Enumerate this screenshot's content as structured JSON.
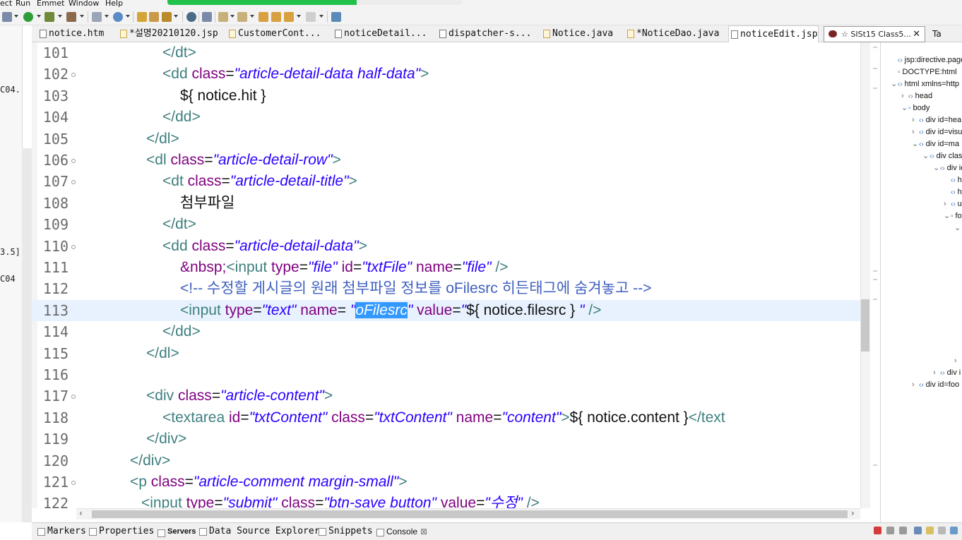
{
  "menu": [
    "ect",
    "Run",
    "Emmet",
    "Window",
    "Help"
  ],
  "progress": 0.64,
  "left_fragments": [
    "C04.",
    "3.5]",
    "C04"
  ],
  "tabs": [
    {
      "label": "notice.htm",
      "kind": "file"
    },
    {
      "label": "*설명20210120.jsp",
      "kind": "java"
    },
    {
      "label": "CustomerCont...",
      "kind": "java"
    },
    {
      "label": "noticeDetail...",
      "kind": "file"
    },
    {
      "label": "dispatcher-s...",
      "kind": "file"
    },
    {
      "label": "Notice.java",
      "kind": "java"
    },
    {
      "label": "*NoticeDao.java",
      "kind": "java"
    },
    {
      "label": "noticeEdit.jsp",
      "kind": "file",
      "active": true
    }
  ],
  "tab_overflow": {
    "label": "☆ SISt15 Class5...",
    "close": "✕"
  },
  "outline_tab": "Ta",
  "code_lines": [
    {
      "n": "101",
      "fold": false,
      "html": "<span class=\"tag\">&lt;/dt&gt;</span>",
      "indent": 230
    },
    {
      "n": "102",
      "fold": true,
      "html": "<span class=\"tag\">&lt;dd </span><span class=\"attr\">class</span><span class=\"txt\">=</span><span class=\"val\">\"article-detail-data half-data\"</span><span class=\"tag\">&gt;</span>",
      "indent": 230
    },
    {
      "n": "103",
      "fold": false,
      "html": "<span class=\"txt\">${ notice.hit }</span>",
      "indent": 255
    },
    {
      "n": "104",
      "fold": false,
      "html": "<span class=\"tag\">&lt;/dd&gt;</span>",
      "indent": 230
    },
    {
      "n": "105",
      "fold": false,
      "html": "<span class=\"tag\">&lt;/dl&gt;</span>",
      "indent": 207
    },
    {
      "n": "106",
      "fold": true,
      "html": "<span class=\"tag\">&lt;dl </span><span class=\"attr\">class</span><span class=\"txt\">=</span><span class=\"val\">\"article-detail-row\"</span><span class=\"tag\">&gt;</span>",
      "indent": 207
    },
    {
      "n": "107",
      "fold": true,
      "html": "<span class=\"tag\">&lt;dt </span><span class=\"attr\">class</span><span class=\"txt\">=</span><span class=\"val\">\"article-detail-title\"</span><span class=\"tag\">&gt;</span>",
      "indent": 230
    },
    {
      "n": "108",
      "fold": false,
      "html": "<span class=\"txt\">첨부파일</span>",
      "indent": 255
    },
    {
      "n": "109",
      "fold": false,
      "html": "<span class=\"tag\">&lt;/dt&gt;</span>",
      "indent": 230
    },
    {
      "n": "110",
      "fold": true,
      "html": "<span class=\"tag\">&lt;dd </span><span class=\"attr\">class</span><span class=\"txt\">=</span><span class=\"val\">\"article-detail-data\"</span><span class=\"tag\">&gt;</span>",
      "indent": 230
    },
    {
      "n": "111",
      "fold": false,
      "html": "<span class=\"attr\">&amp;nbsp;</span><span class=\"tag\">&lt;input </span><span class=\"attr\">type</span><span class=\"txt\">=</span><span class=\"val\">\"file\"</span><span class=\"attr\"> id</span><span class=\"txt\">=</span><span class=\"val\">\"txtFile\"</span><span class=\"attr\"> name</span><span class=\"txt\">=</span><span class=\"val\">\"file\"</span><span class=\"tag\"> /&gt;</span>",
      "indent": 255
    },
    {
      "n": "112",
      "fold": false,
      "html": "<span class=\"cmt\">&lt;!-- 수정할 게시글의 원래 첨부파일 정보를 oFilesrc 히든태그에 숨겨놓고 --&gt;</span>",
      "indent": 255
    },
    {
      "n": "113",
      "fold": false,
      "current": true,
      "html": "<span class=\"tag\">&lt;input </span><span class=\"attr\">type</span><span class=\"txt\">=</span><span class=\"val\">\"text\"</span><span class=\"attr\"> name</span><span class=\"txt\">=</span><span class=\"val\"> \"</span><span class=\"sel\">oFilesrc</span><span class=\"val\">\"</span><span class=\"attr\"> value</span><span class=\"txt\">=</span><span class=\"val\">\"</span><span class=\"txt\">${ notice.filesrc }</span><span class=\"val\"> \"</span><span class=\"tag\"> /&gt;</span>",
      "indent": 255
    },
    {
      "n": "114",
      "fold": false,
      "html": "<span class=\"tag\">&lt;/dd&gt;</span>",
      "indent": 230
    },
    {
      "n": "115",
      "fold": false,
      "html": "<span class=\"tag\">&lt;/dl&gt;</span>",
      "indent": 207
    },
    {
      "n": "116",
      "fold": false,
      "html": "",
      "indent": 207
    },
    {
      "n": "117",
      "fold": true,
      "html": "<span class=\"tag\">&lt;div </span><span class=\"attr\">class</span><span class=\"txt\">=</span><span class=\"val\">\"article-content\"</span><span class=\"tag\">&gt;</span>",
      "indent": 207
    },
    {
      "n": "118",
      "fold": false,
      "html": "<span class=\"tag\">&lt;textarea </span><span class=\"attr\">id</span><span class=\"txt\">=</span><span class=\"val\">\"txtContent\"</span><span class=\"attr\"> class</span><span class=\"txt\">=</span><span class=\"val\">\"txtContent\"</span><span class=\"attr\"> name</span><span class=\"txt\">=</span><span class=\"val\">\"content\"</span><span class=\"tag\">&gt;</span><span class=\"txt\">${ notice.content }</span><span class=\"tag\">&lt;/text</span>",
      "indent": 230
    },
    {
      "n": "119",
      "fold": false,
      "html": "<span class=\"tag\">&lt;/div&gt;</span>",
      "indent": 207
    },
    {
      "n": "120",
      "fold": false,
      "html": "<span class=\"tag\">&lt;/div&gt;</span>",
      "indent": 184
    },
    {
      "n": "121",
      "fold": true,
      "html": "<span class=\"tag\">&lt;p </span><span class=\"attr\">class</span><span class=\"txt\">=</span><span class=\"val\">\"article-comment margin-small\"</span><span class=\"tag\">&gt;</span>",
      "indent": 184
    },
    {
      "n": "122",
      "fold": false,
      "html": "<span class=\"tag\">&lt;input </span><span class=\"attr\">type</span><span class=\"txt\">=</span><span class=\"val\">\"submit\"</span><span class=\"attr\"> class</span><span class=\"txt\">=</span><span class=\"val\">\"btn-save button\"</span><span class=\"attr\"> value</span><span class=\"txt\">=</span><span class=\"val\">\"수정\"</span><span class=\"tag\"> /&gt;</span>",
      "indent": 200
    }
  ],
  "outline": [
    {
      "label": "jsp:directive.page",
      "level": 0,
      "twist": "",
      "icon": "<>"
    },
    {
      "label": "DOCTYPE:html",
      "level": 0,
      "twist": "",
      "icon": "☐"
    },
    {
      "label": "html xmlns=http",
      "level": 0,
      "twist": "v",
      "icon": "<>"
    },
    {
      "label": "head",
      "level": 1,
      "twist": ">",
      "icon": "<>"
    },
    {
      "label": "body",
      "level": 1,
      "twist": "v",
      "icon": "☐"
    },
    {
      "label": "div id=hea",
      "level": 2,
      "twist": ">",
      "icon": "<>"
    },
    {
      "label": "div id=visu",
      "level": 2,
      "twist": ">",
      "icon": "<>"
    },
    {
      "label": "div id=ma",
      "level": 2,
      "twist": "v",
      "icon": "<>"
    },
    {
      "label": "div clas",
      "level": 3,
      "twist": "v",
      "icon": "<>"
    },
    {
      "label": "div id",
      "level": 4,
      "twist": "v",
      "icon": "<>"
    },
    {
      "label": "h:",
      "level": 5,
      "twist": "",
      "icon": "<>"
    },
    {
      "label": "h:",
      "level": 5,
      "twist": "",
      "icon": "<>"
    },
    {
      "label": "ul",
      "level": 5,
      "twist": ">",
      "icon": "<>"
    },
    {
      "label": "fo",
      "level": 5,
      "twist": "v",
      "icon": "☐"
    },
    {
      "label": "<",
      "level": 6,
      "twist": "v",
      "icon": ""
    },
    {
      "label": "",
      "level": 7,
      "twist": ">",
      "icon": ""
    },
    {
      "label": "",
      "level": 7,
      "twist": ">",
      "icon": ""
    },
    {
      "label": "",
      "level": 7,
      "twist": ">",
      "icon": ""
    },
    {
      "label": "",
      "level": 7,
      "twist": "v",
      "icon": ""
    }
  ],
  "outline_tail": [
    {
      "label": "",
      "twist": ">",
      "icon": "",
      "level": 7
    },
    {
      "label": "<",
      "twist": ">",
      "icon": "",
      "level": 6
    },
    {
      "label": "div i",
      "twist": ">",
      "icon": "<>",
      "level": 4
    },
    {
      "label": "div id=foo",
      "twist": ">",
      "icon": "<>",
      "level": 2
    }
  ],
  "bottom_views": [
    {
      "label": "Markers",
      "style": ""
    },
    {
      "label": "Properties",
      "style": ""
    },
    {
      "label": "Servers",
      "style": "bold"
    },
    {
      "label": "Data Source Explorer",
      "style": ""
    },
    {
      "label": "Snippets",
      "style": ""
    },
    {
      "label": "Console",
      "style": "console",
      "close": "⊠"
    }
  ],
  "colors": {
    "tag": "#3f7f7f",
    "attribute": "#7f007f",
    "value": "#2a00ff",
    "comment": "#3f5fbf",
    "selection": "#3399ff",
    "current_line": "#e8f2fe"
  }
}
